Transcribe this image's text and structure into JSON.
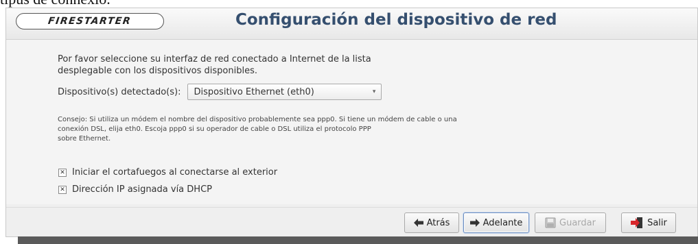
{
  "doc_text": "tipus de connexió.",
  "window": {
    "logo_text": "FIRESTARTER",
    "title": "Configuración del dispositivo de red"
  },
  "intro": {
    "line1": "Por favor seleccione su interfaz de red conectado a Internet de la lista",
    "line2": "desplegable con los dispositivos disponibles."
  },
  "device": {
    "label": "Dispositivo(s) detectado(s):",
    "selected": "Dispositivo Ethernet (eth0)"
  },
  "tip": {
    "line1": "Consejo: Si utiliza un módem el nombre del dispositivo probablemente sea ppp0. Si tiene un módem de cable o una",
    "line2": "conexión DSL, elija eth0. Escoja ppp0 si su operador de cable o DSL utiliza el protocolo PPP",
    "line3": "sobre Ethernet."
  },
  "options": [
    {
      "label": "Iniciar el cortafuegos al conectarse al exterior",
      "checked": true
    },
    {
      "label": "Dirección IP asignada vía DHCP",
      "checked": true
    }
  ],
  "buttons": {
    "back": {
      "label": "Atrás",
      "icon": "arrow-left-icon",
      "enabled": true
    },
    "forward": {
      "label": "Adelante",
      "icon": "arrow-right-icon",
      "enabled": true
    },
    "save": {
      "label": "Guardar",
      "icon": "floppy-disk-icon",
      "enabled": false
    },
    "quit": {
      "label": "Salir",
      "icon": "exit-icon",
      "enabled": true
    }
  },
  "colors": {
    "title": "#354f6f",
    "exit_arrow": "#d8262b"
  }
}
